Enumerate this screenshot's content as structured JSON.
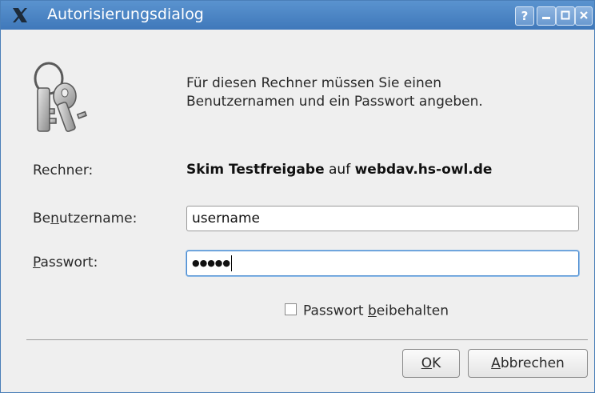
{
  "window": {
    "title": "Autorisierungsdialog",
    "help_label": "?"
  },
  "icons": {
    "app": "x-logo-icon",
    "keys": "keys-icon",
    "minimize": "minimize-icon",
    "maximize": "maximize-icon",
    "close": "close-icon"
  },
  "message": {
    "line1": "Für diesen Rechner müssen Sie einen",
    "line2": "Benutzernamen und ein Passwort angeben."
  },
  "form": {
    "host_label": "Rechner:",
    "host_share": "Skim Testfreigabe",
    "host_connector": " auf ",
    "host_server": "webdav.hs-owl.de",
    "username_label_pre": "Be",
    "username_label_accel": "n",
    "username_label_post": "utzername:",
    "username_value": "username",
    "password_label_accel": "P",
    "password_label_post": "asswort:",
    "password_value": "●●●●●",
    "remember_pre": "Passwort ",
    "remember_accel": "b",
    "remember_post": "eibehalten",
    "remember_checked": false
  },
  "buttons": {
    "ok_accel": "O",
    "ok_rest": "K",
    "cancel_accel": "A",
    "cancel_rest": "bbrechen"
  },
  "colors": {
    "titlebar": "#4a85c5",
    "background": "#efefef",
    "focus": "#4a8bd0"
  }
}
